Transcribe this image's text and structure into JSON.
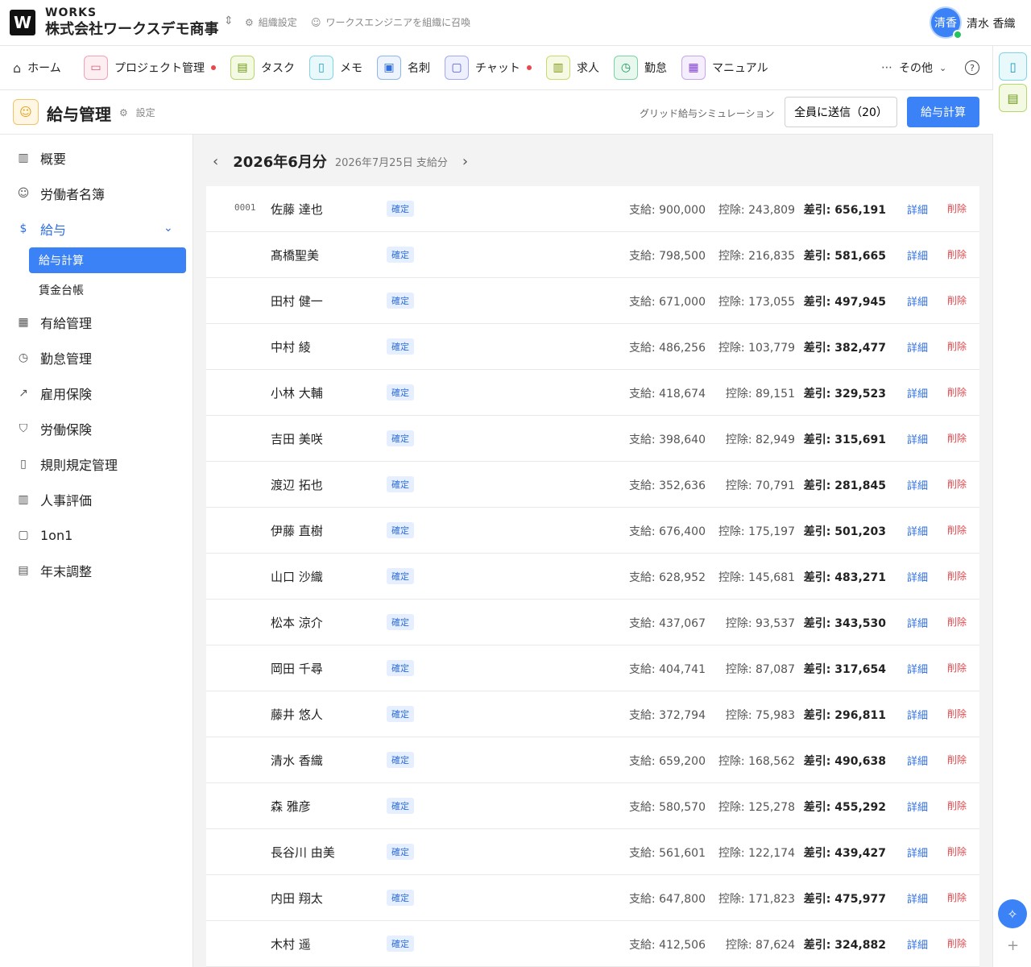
{
  "header": {
    "logo": "W",
    "brand": "WORKS",
    "company": "株式会社ワークスデモ商事",
    "org_settings": "組織設定",
    "invite": "ワークスエンジニアを組織に召喚",
    "avatar": "清香",
    "user_name": "清水 香織"
  },
  "nav": {
    "home": "ホーム",
    "project": "プロジェクト管理",
    "task": "タスク",
    "memo": "メモ",
    "card": "名刺",
    "chat": "チャット",
    "job": "求人",
    "attendance": "勤怠",
    "manual": "マニュアル",
    "more": "その他"
  },
  "page": {
    "title": "給与管理",
    "settings": "設定",
    "simulation": "グリッド給与シミュレーション",
    "send_all": "全員に送信（20）",
    "calc": "給与計算"
  },
  "sidebar": {
    "items": [
      "概要",
      "労働者名簿",
      "給与",
      "有給管理",
      "勤怠管理",
      "雇用保険",
      "労働保険",
      "規則規定管理",
      "人事評価",
      "1on1",
      "年末調整"
    ],
    "sub_active": "給与計算",
    "sub_item": "賃金台帳"
  },
  "period": {
    "month": "2026年6月分",
    "paydate": "2026年7月25日 支給分"
  },
  "labels": {
    "status": "確定",
    "detail": "詳細",
    "delete": "削除"
  },
  "rows": [
    {
      "code": "0001",
      "name": "佐藤 達也",
      "pay": "支給: 900,000",
      "ded": "控除: 243,809",
      "net": "差引: 656,191"
    },
    {
      "code": "",
      "name": "髙橋聖美",
      "pay": "支給: 798,500",
      "ded": "控除: 216,835",
      "net": "差引: 581,665"
    },
    {
      "code": "",
      "name": "田村 健一",
      "pay": "支給: 671,000",
      "ded": "控除: 173,055",
      "net": "差引: 497,945"
    },
    {
      "code": "",
      "name": "中村 綾",
      "pay": "支給: 486,256",
      "ded": "控除: 103,779",
      "net": "差引: 382,477"
    },
    {
      "code": "",
      "name": "小林 大輔",
      "pay": "支給: 418,674",
      "ded": "控除: 89,151",
      "net": "差引: 329,523"
    },
    {
      "code": "",
      "name": "吉田 美咲",
      "pay": "支給: 398,640",
      "ded": "控除: 82,949",
      "net": "差引: 315,691"
    },
    {
      "code": "",
      "name": "渡辺 拓也",
      "pay": "支給: 352,636",
      "ded": "控除: 70,791",
      "net": "差引: 281,845"
    },
    {
      "code": "",
      "name": "伊藤 直樹",
      "pay": "支給: 676,400",
      "ded": "控除: 175,197",
      "net": "差引: 501,203"
    },
    {
      "code": "",
      "name": "山口 沙織",
      "pay": "支給: 628,952",
      "ded": "控除: 145,681",
      "net": "差引: 483,271"
    },
    {
      "code": "",
      "name": "松本 涼介",
      "pay": "支給: 437,067",
      "ded": "控除: 93,537",
      "net": "差引: 343,530"
    },
    {
      "code": "",
      "name": "岡田 千尋",
      "pay": "支給: 404,741",
      "ded": "控除: 87,087",
      "net": "差引: 317,654"
    },
    {
      "code": "",
      "name": "藤井 悠人",
      "pay": "支給: 372,794",
      "ded": "控除: 75,983",
      "net": "差引: 296,811"
    },
    {
      "code": "",
      "name": "清水 香織",
      "pay": "支給: 659,200",
      "ded": "控除: 168,562",
      "net": "差引: 490,638"
    },
    {
      "code": "",
      "name": "森 雅彦",
      "pay": "支給: 580,570",
      "ded": "控除: 125,278",
      "net": "差引: 455,292"
    },
    {
      "code": "",
      "name": "長谷川 由美",
      "pay": "支給: 561,601",
      "ded": "控除: 122,174",
      "net": "差引: 439,427"
    },
    {
      "code": "",
      "name": "内田 翔太",
      "pay": "支給: 647,800",
      "ded": "控除: 171,823",
      "net": "差引: 475,977"
    },
    {
      "code": "",
      "name": "木村 遥",
      "pay": "支給: 412,506",
      "ded": "控除: 87,624",
      "net": "差引: 324,882"
    }
  ],
  "icons": {
    "home": "home-icon",
    "project": "folder-icon",
    "task": "clipboard-icon",
    "memo": "document-icon",
    "card": "id-card-icon",
    "chat": "chat-icon",
    "job": "briefcase-icon",
    "attendance": "clock-icon",
    "manual": "book-icon"
  },
  "colors": {
    "accent": "#3b82f6",
    "danger": "#e5484d",
    "online": "#22c55e"
  }
}
